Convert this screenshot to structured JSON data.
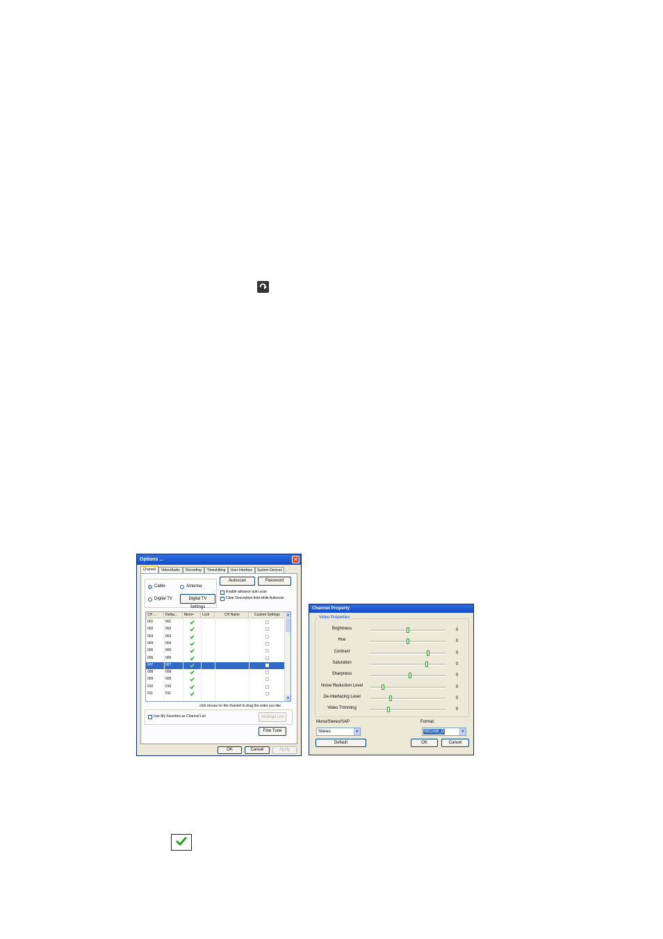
{
  "options_dialog": {
    "title": "Options ...",
    "tabs": [
      "Channel",
      "Video/Audio",
      "Recording",
      "Timeshifting",
      "User Interface",
      "System Devices"
    ],
    "radio_cable": "Cable",
    "radio_antenna": "Antenna",
    "radio_digital": "Digital TV",
    "digital_settings_button": "Digital TV Settings",
    "autoscan_button": "Autoscan",
    "password_button": "Password",
    "enable_advance_scan": "Enable advance auto scan",
    "clear_description": "Clear Description field while Autoscan",
    "columns": [
      "CH ...",
      "Defau...",
      "Mem+",
      "Lock",
      "CH Name",
      "Custom Settings"
    ],
    "rows": [
      {
        "ch": "001",
        "def": "001"
      },
      {
        "ch": "002",
        "def": "002"
      },
      {
        "ch": "003",
        "def": "003"
      },
      {
        "ch": "004",
        "def": "004"
      },
      {
        "ch": "005",
        "def": "005"
      },
      {
        "ch": "006",
        "def": "006"
      },
      {
        "ch": "007",
        "def": "007"
      },
      {
        "ch": "008",
        "def": "008"
      },
      {
        "ch": "009",
        "def": "009"
      },
      {
        "ch": "010",
        "def": "010"
      },
      {
        "ch": "011",
        "def": "011"
      }
    ],
    "selected_row_index": 6,
    "hint": "click mouse on the channel to drag the order you like",
    "use_favorites": "Use My Favorites as Channel List",
    "arrange_list_button": "Arrange List",
    "fine_tune_button": "Fine Tune",
    "ok_button": "OK",
    "cancel_button": "Cancel",
    "apply_button": "Apply"
  },
  "channel_property_dialog": {
    "title": "Channel Property",
    "group_label": "Video Properties",
    "sliders": [
      {
        "label": "Brightness",
        "value": "0",
        "level": 0.5
      },
      {
        "label": "Hue",
        "value": "0",
        "level": 0.5
      },
      {
        "label": "Contrast",
        "value": "0",
        "level": 0.77
      },
      {
        "label": "Saturation",
        "value": "0",
        "level": 0.75
      },
      {
        "label": "Sharpness",
        "value": "0",
        "level": 0.53
      },
      {
        "label": "Noise Reduction Level",
        "value": "0",
        "level": 0.17
      },
      {
        "label": "De-Interlacing Level",
        "value": "0",
        "level": 0.27
      },
      {
        "label": "Video Trimming",
        "value": "0",
        "level": 0.24
      }
    ],
    "audio_label": "Mono/Stereo/SAP",
    "audio_value": "Stereo",
    "format_label": "Format",
    "format_value": "SECAM_D",
    "default_button": "Default",
    "ok_button": "OK",
    "cancel_button": "Cancel"
  },
  "icons": {
    "loop": "loop-arrow-icon",
    "check": "green-check-icon"
  },
  "colors": {
    "title_blue": "#1249c8",
    "check_green": "#21a121",
    "selection": "#316ac5"
  }
}
